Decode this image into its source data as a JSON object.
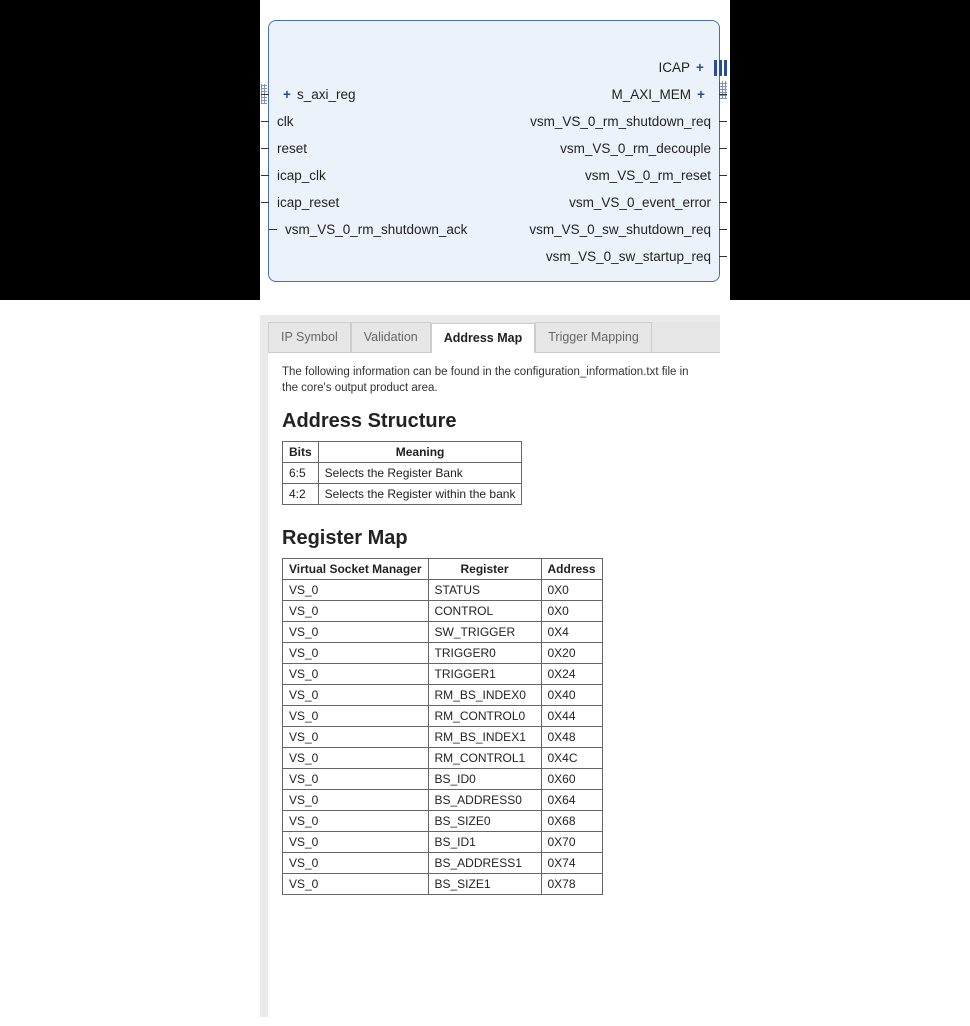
{
  "ip_block": {
    "left_ports": [
      {
        "label": "s_axi_reg",
        "bus": true
      },
      {
        "label": "clk",
        "bus": false
      },
      {
        "label": "reset",
        "bus": false
      },
      {
        "label": "icap_clk",
        "bus": false
      },
      {
        "label": "icap_reset",
        "bus": false
      }
    ],
    "right_ports": [
      {
        "label": "ICAP",
        "bus": true,
        "icap": true
      },
      {
        "label": "M_AXI_MEM",
        "bus": true
      },
      {
        "label": "vsm_VS_0_rm_shutdown_req",
        "bus": false
      },
      {
        "label": "vsm_VS_0_rm_decouple",
        "bus": false
      },
      {
        "label": "vsm_VS_0_rm_reset",
        "bus": false
      },
      {
        "label": "vsm_VS_0_event_error",
        "bus": false
      }
    ],
    "bottom_left": {
      "label": "vsm_VS_0_rm_shutdown_ack"
    },
    "bottom_right_stack": [
      {
        "label": "vsm_VS_0_sw_shutdown_req"
      },
      {
        "label": "vsm_VS_0_sw_startup_req"
      }
    ]
  },
  "tabs": [
    {
      "label": "IP Symbol",
      "active": false
    },
    {
      "label": "Validation",
      "active": false
    },
    {
      "label": "Address Map",
      "active": true
    },
    {
      "label": "Trigger Mapping",
      "active": false
    }
  ],
  "intro_text": "The following information can be found in the configuration_information.txt file in the core's output product area.",
  "address_structure": {
    "heading": "Address Structure",
    "columns": [
      "Bits",
      "Meaning"
    ],
    "rows": [
      {
        "bits": "6:5",
        "meaning": "Selects the Register Bank"
      },
      {
        "bits": "4:2",
        "meaning": "Selects the Register within the bank"
      }
    ]
  },
  "register_map": {
    "heading": "Register Map",
    "columns": [
      "Virtual Socket Manager",
      "Register",
      "Address"
    ],
    "rows": [
      {
        "vsm": "VS_0",
        "reg": "STATUS",
        "addr": "0X0"
      },
      {
        "vsm": "VS_0",
        "reg": "CONTROL",
        "addr": "0X0"
      },
      {
        "vsm": "VS_0",
        "reg": "SW_TRIGGER",
        "addr": "0X4"
      },
      {
        "vsm": "VS_0",
        "reg": "TRIGGER0",
        "addr": "0X20"
      },
      {
        "vsm": "VS_0",
        "reg": "TRIGGER1",
        "addr": "0X24"
      },
      {
        "vsm": "VS_0",
        "reg": "RM_BS_INDEX0",
        "addr": "0X40"
      },
      {
        "vsm": "VS_0",
        "reg": "RM_CONTROL0",
        "addr": "0X44"
      },
      {
        "vsm": "VS_0",
        "reg": "RM_BS_INDEX1",
        "addr": "0X48"
      },
      {
        "vsm": "VS_0",
        "reg": "RM_CONTROL1",
        "addr": "0X4C"
      },
      {
        "vsm": "VS_0",
        "reg": "BS_ID0",
        "addr": "0X60"
      },
      {
        "vsm": "VS_0",
        "reg": "BS_ADDRESS0",
        "addr": "0X64"
      },
      {
        "vsm": "VS_0",
        "reg": "BS_SIZE0",
        "addr": "0X68"
      },
      {
        "vsm": "VS_0",
        "reg": "BS_ID1",
        "addr": "0X70"
      },
      {
        "vsm": "VS_0",
        "reg": "BS_ADDRESS1",
        "addr": "0X74"
      },
      {
        "vsm": "VS_0",
        "reg": "BS_SIZE1",
        "addr": "0X78"
      }
    ]
  }
}
